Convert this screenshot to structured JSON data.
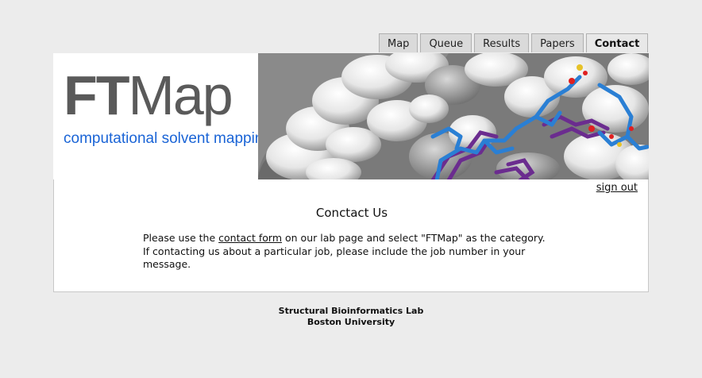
{
  "tabs": [
    {
      "label": "Map",
      "active": false
    },
    {
      "label": "Queue",
      "active": false
    },
    {
      "label": "Results",
      "active": false
    },
    {
      "label": "Papers",
      "active": false
    },
    {
      "label": "Contact",
      "active": true
    }
  ],
  "banner": {
    "logo_bold": "FT",
    "logo_light": "Map",
    "tagline": "computational solvent mapping"
  },
  "content": {
    "signout_label": "sign out",
    "heading": "Conctact Us",
    "message_pre": "Please use the ",
    "message_link": "contact form",
    "message_post": " on our lab page and select \"FTMap\" as the category.",
    "message_line2": "If contacting us about a particular job, please include the job number in your message."
  },
  "footer": {
    "line1": "Structural Bioinformatics Lab",
    "line2": "Boston University"
  },
  "colors": {
    "tagline": "#1a64d6",
    "logo": "#5a5a5a",
    "background": "#ececec"
  }
}
